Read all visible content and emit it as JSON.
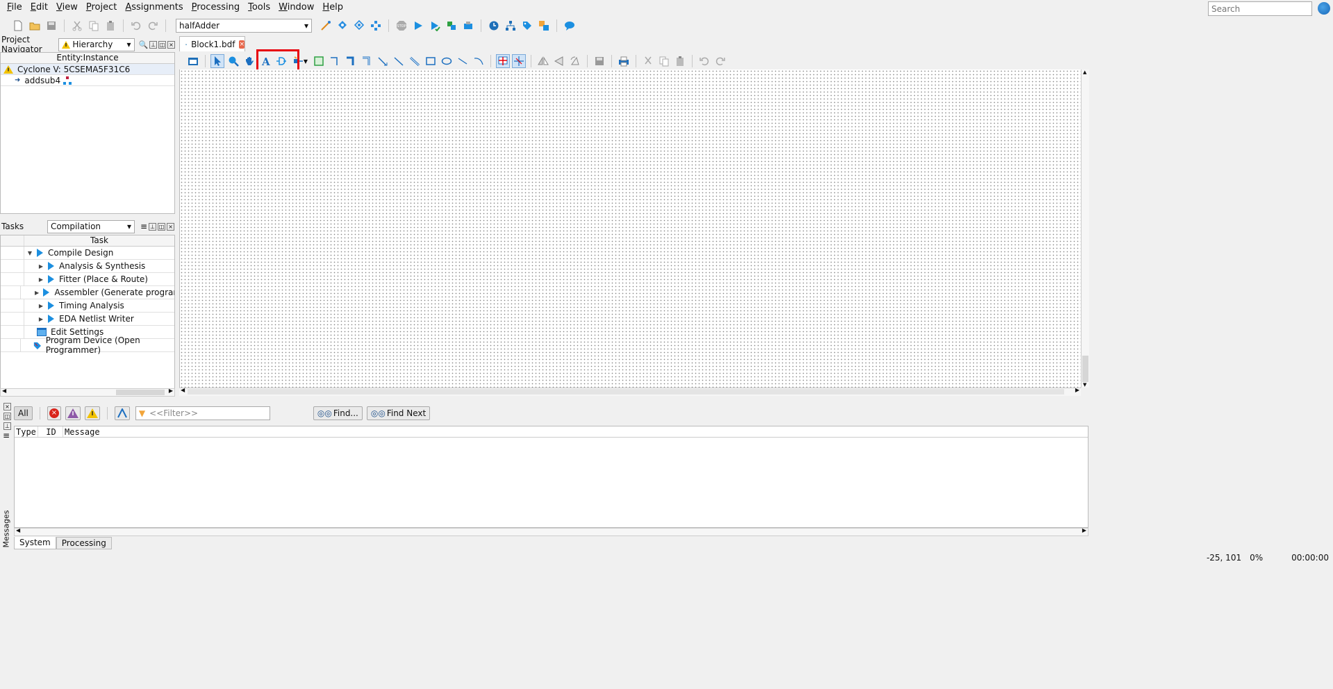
{
  "menu": [
    "File",
    "Edit",
    "View",
    "Project",
    "Assignments",
    "Processing",
    "Tools",
    "Window",
    "Help"
  ],
  "search": {
    "placeholder": "Search"
  },
  "toolbar": {
    "revision": "halfAdder"
  },
  "navigator": {
    "title": "Project Navigator",
    "view": "Hierarchy",
    "column": "Entity:Instance",
    "device": "Cyclone V: 5CSEMA5F31C6",
    "entity": "addsub4"
  },
  "tasks": {
    "title": "Tasks",
    "flow": "Compilation",
    "column": "Task",
    "items": [
      {
        "label": "Compile Design",
        "level": 0
      },
      {
        "label": "Analysis & Synthesis",
        "level": 1
      },
      {
        "label": "Fitter (Place & Route)",
        "level": 1
      },
      {
        "label": "Assembler (Generate programmin",
        "level": 1
      },
      {
        "label": "Timing Analysis",
        "level": 1
      },
      {
        "label": "EDA Netlist Writer",
        "level": 1
      }
    ],
    "edit_settings": "Edit Settings",
    "program_device": "Program Device (Open Programmer)"
  },
  "editor": {
    "tab": "Block1.bdf"
  },
  "messages": {
    "all": "All",
    "filter_placeholder": "<<Filter>>",
    "find": "Find...",
    "find_next": "Find Next",
    "columns": [
      "Type",
      "ID",
      "Message"
    ],
    "side_label": "Messages",
    "tabs": [
      "System",
      "Processing"
    ]
  },
  "status": {
    "coords": "-25, 101",
    "percent": "0%",
    "time": "00:00:00"
  },
  "colors": {
    "accent": "#1c8fe0",
    "highlight": "#e8000b"
  }
}
